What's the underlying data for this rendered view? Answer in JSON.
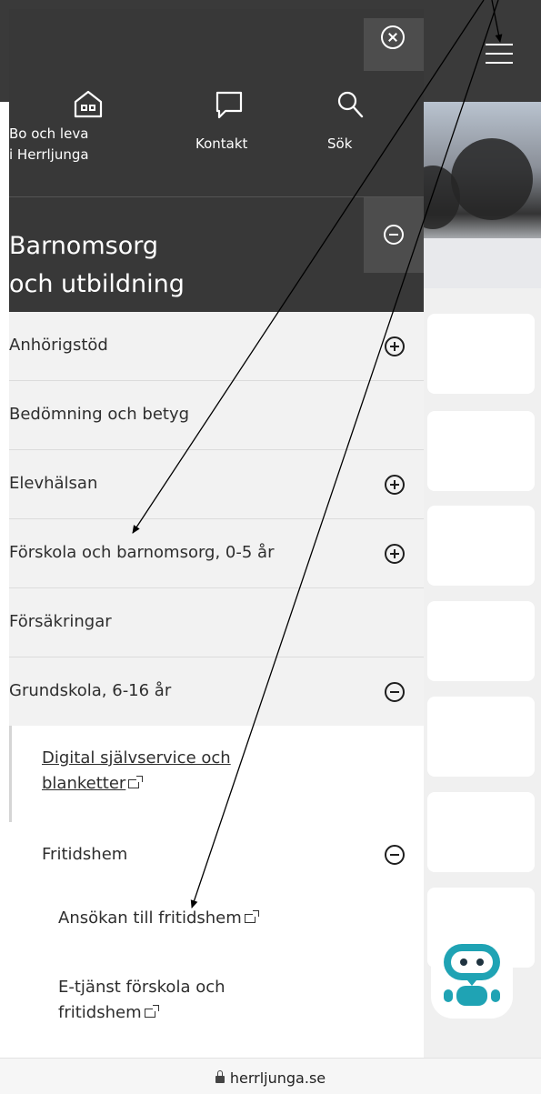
{
  "drawer": {
    "quick_links": [
      {
        "label_line1": "Bo och leva",
        "label_line2": "i Herrljunga",
        "icon": "house-icon"
      },
      {
        "label_line1": "Kontakt",
        "icon": "chat-bubble-icon"
      },
      {
        "label_line1": "Sök",
        "icon": "search-icon"
      }
    ],
    "section": {
      "title_line1": "Barnomsorg",
      "title_line2": "och utbildning"
    },
    "items": [
      {
        "label": "Anhörigstöd",
        "toggle": "plus"
      },
      {
        "label": "Bedömning och betyg",
        "toggle": "none"
      },
      {
        "label": "Elevhälsan",
        "toggle": "plus"
      },
      {
        "label": "Förskola och barnomsorg, 0-5 år",
        "toggle": "plus"
      },
      {
        "label": "Försäkringar",
        "toggle": "none"
      },
      {
        "label": "Grundskola, 6-16 år",
        "toggle": "minus"
      }
    ],
    "sub": {
      "link_line1": "Digital självservice och",
      "link_line2": "blanketter",
      "fritidshem": "Fritidshem",
      "ansokan": "Ansökan till fritidshem",
      "etjanst_line1": "E-tjänst förskola och",
      "etjanst_line2": "fritidshem"
    }
  },
  "browser": {
    "url": "herrljunga.se"
  },
  "colors": {
    "drawer_dark": "#383838",
    "drawer_light": "#f2f2f2",
    "robot_teal": "#1fa3b4"
  }
}
